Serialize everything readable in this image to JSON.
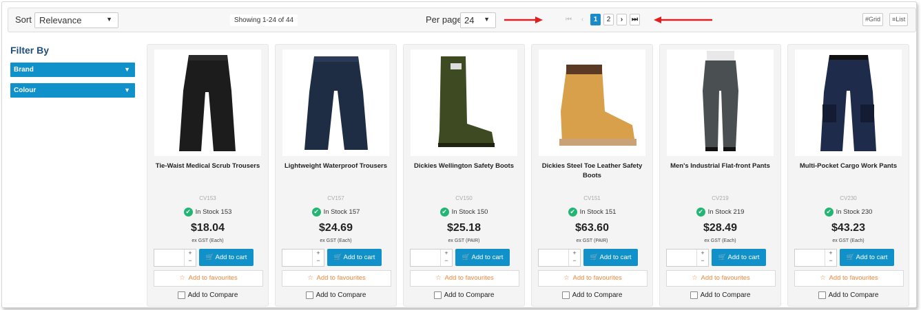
{
  "toolbar": {
    "sort_label": "Sort",
    "sort_value": "Relevance",
    "showing": "Showing 1-24 of 44",
    "per_page_label": "Per page",
    "per_page_value": "24",
    "pages": [
      "1",
      "2"
    ],
    "current_page": "1",
    "grid_label": "Grid",
    "list_label": "List"
  },
  "sidebar": {
    "title": "Filter By",
    "facets": [
      {
        "label": "Brand"
      },
      {
        "label": "Colour"
      }
    ]
  },
  "products": [
    {
      "name": "Tie-Waist Medical Scrub Trousers",
      "sku": "CV153",
      "stock": "In Stock 153",
      "price": "$18.04",
      "unit": "ex GST (Each)",
      "image": "trousers-black"
    },
    {
      "name": "Lightweight Waterproof Trousers",
      "sku": "CV157",
      "stock": "In Stock 157",
      "price": "$24.69",
      "unit": "ex GST (Each)",
      "image": "trousers-navy"
    },
    {
      "name": "Dickies Wellington Safety Boots",
      "sku": "CV150",
      "stock": "In Stock 150",
      "price": "$25.18",
      "unit": "ex GST (PAIR)",
      "image": "wellington-boot"
    },
    {
      "name": "Dickies Steel Toe Leather Safety Boots",
      "sku": "CV151",
      "stock": "In Stock 151",
      "price": "$63.60",
      "unit": "ex GST (PAIR)",
      "image": "leather-boot"
    },
    {
      "name": "Men's Industrial Flat-front Pants",
      "sku": "CV219",
      "stock": "In Stock 219",
      "price": "$28.49",
      "unit": "ex GST (Each)",
      "image": "grey-pants"
    },
    {
      "name": "Multi-Pocket Cargo Work Pants",
      "sku": "CV230",
      "stock": "In Stock 230",
      "price": "$43.23",
      "unit": "ex GST (Each)",
      "image": "cargo-pants"
    }
  ],
  "card_labels": {
    "add_to_cart": "Add to cart",
    "add_to_favourites": "Add to favourites",
    "add_to_compare": "Add to Compare"
  },
  "colors": {
    "accent": "#1191c9",
    "stock_green": "#22b573",
    "favourite_orange": "#f0883e",
    "annotation_red": "#e02020"
  }
}
